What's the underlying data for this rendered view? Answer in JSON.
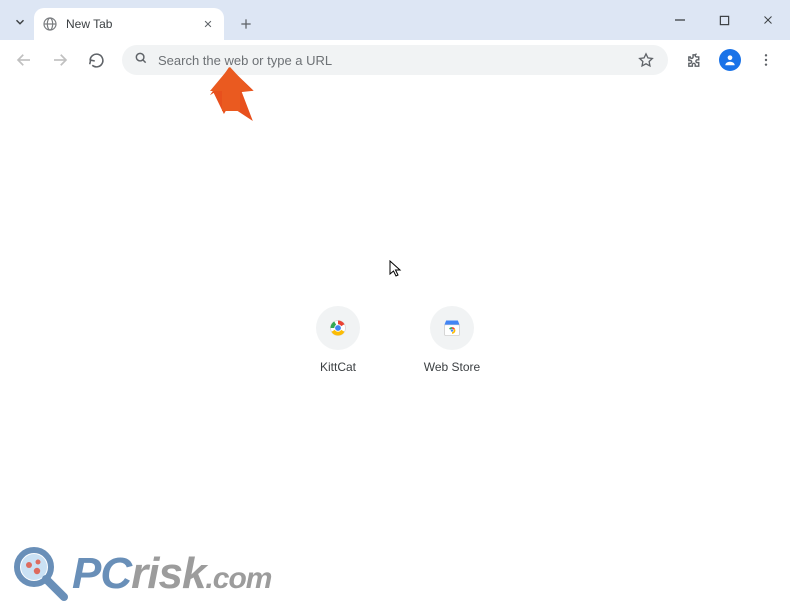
{
  "tab": {
    "title": "New Tab"
  },
  "omnibox": {
    "placeholder": "Search the web or type a URL"
  },
  "shortcuts": [
    {
      "label": "KittCat"
    },
    {
      "label": "Web Store"
    }
  ],
  "watermark": {
    "prefix": "PC",
    "brand": "risk",
    "suffix": ".com"
  }
}
